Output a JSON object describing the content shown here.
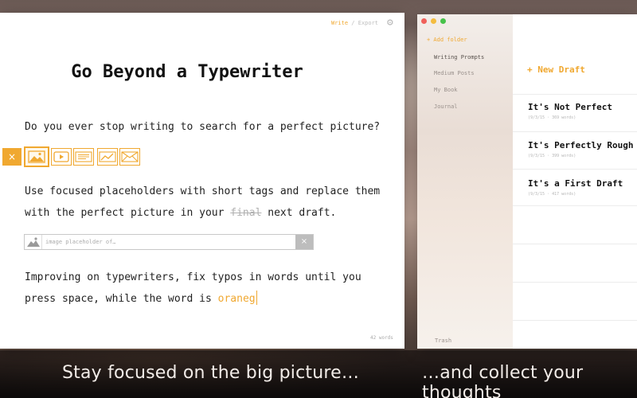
{
  "editor": {
    "nav": {
      "write": "Write",
      "sep": " / ",
      "export": "Export"
    },
    "title": "Go Beyond a Typewriter",
    "para1": "Do you ever stop writing to search for a perfect picture?",
    "para2_a": "Use focused placeholders with short tags and replace them",
    "para2_b": "with the perfect picture in your ",
    "para2_strike": "final",
    "para2_c": " next draft.",
    "para3_a": "Improving on typewriters, fix typos in words until you",
    "para3_b": "press space, while the word is ",
    "para3_typo": "oraneg",
    "placeholder_input": "image placeholder of…",
    "close_glyph": "×",
    "word_count": "42 words",
    "icons": [
      "image-icon",
      "video-icon",
      "text-block-icon",
      "chart-icon",
      "mail-icon"
    ]
  },
  "library": {
    "add_folder": "+ Add folder",
    "folders": [
      "Writing Prompts",
      "Medium Posts",
      "My Book",
      "Journal"
    ],
    "trash": "Trash",
    "new_draft": "+ New Draft",
    "drafts": [
      {
        "title": "It's Not Perfect",
        "meta": "(9/3/15 · 369 words)"
      },
      {
        "title": "It's Perfectly Rough",
        "meta": "(9/3/15 · 399 words)"
      },
      {
        "title": "It's a First Draft",
        "meta": "(9/3/15 · 417 words)"
      }
    ]
  },
  "captions": {
    "left": "Stay focused on the big picture…",
    "right": "…and collect your thoughts"
  },
  "colors": {
    "accent": "#f0a830",
    "muted": "#b0b0b0"
  }
}
